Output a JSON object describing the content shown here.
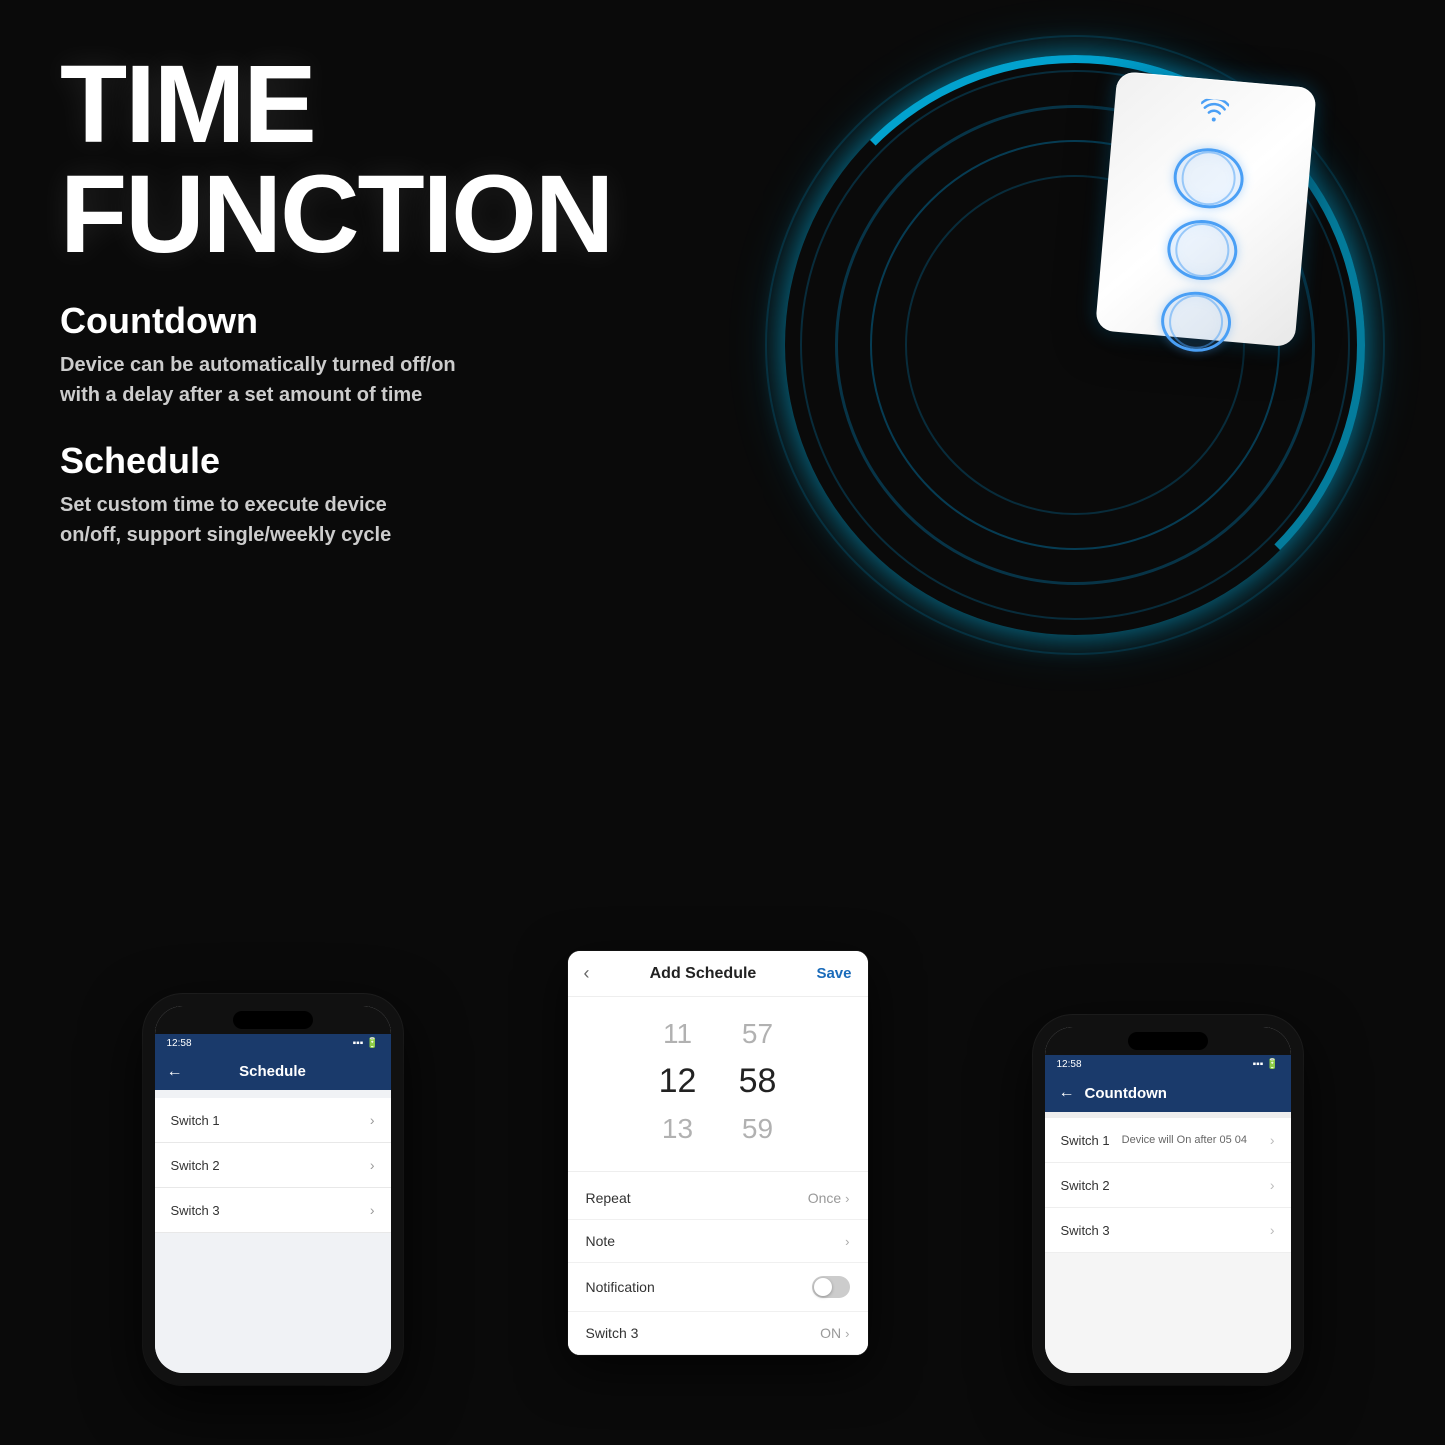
{
  "page": {
    "background_color": "#0a0a0a"
  },
  "hero": {
    "title_line1": "TIME",
    "title_line2": "FUNCTION"
  },
  "features": {
    "countdown": {
      "heading": "Countdown",
      "description_line1": "Device can be automatically turned off/on",
      "description_line2": "with a delay after a set amount of time"
    },
    "schedule": {
      "heading": "Schedule",
      "description_line1": "Set custom time to execute device",
      "description_line2": "on/off, support single/weekly cycle"
    }
  },
  "phone1": {
    "status_time": "12:58",
    "header_title": "Schedule",
    "back_icon": "←",
    "items": [
      {
        "label": "Switch 1",
        "chevron": "›"
      },
      {
        "label": "Switch 2",
        "chevron": "›"
      },
      {
        "label": "Switch 3",
        "chevron": "›"
      }
    ]
  },
  "phone2": {
    "header_title": "Add Schedule",
    "back_icon": "‹",
    "save_label": "Save",
    "time_picker": {
      "row1": {
        "hour": "11",
        "minute": "57"
      },
      "row2": {
        "hour": "12",
        "minute": "58"
      },
      "row3": {
        "hour": "13",
        "minute": "59"
      }
    },
    "rows": [
      {
        "label": "Repeat",
        "value": "Once",
        "type": "value"
      },
      {
        "label": "Note",
        "value": "",
        "type": "arrow"
      },
      {
        "label": "Notification",
        "value": "",
        "type": "toggle"
      },
      {
        "label": "Switch 3",
        "value": "ON",
        "type": "value"
      }
    ]
  },
  "phone3": {
    "status_time": "12:58",
    "header_title": "Countdown",
    "back_icon": "←",
    "items": [
      {
        "name": "Switch 1",
        "desc": "Device will On after 05 04",
        "chevron": "›"
      },
      {
        "name": "Switch 2",
        "desc": "",
        "chevron": "›"
      },
      {
        "name": "Switch 3",
        "desc": "",
        "chevron": "›"
      }
    ]
  },
  "device": {
    "wifi_icon": "📶",
    "buttons": 3
  }
}
